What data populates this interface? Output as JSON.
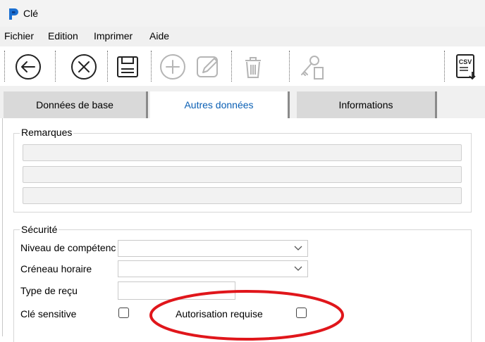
{
  "window": {
    "title": "Clé"
  },
  "menu": {
    "items": [
      "Fichier",
      "Edition",
      "Imprimer",
      "Aide"
    ]
  },
  "toolbar": {
    "buttons": [
      {
        "icon": "back-arrow-icon",
        "enabled": true
      },
      {
        "icon": "cancel-x-icon",
        "enabled": true
      },
      {
        "icon": "save-floppy-icon",
        "enabled": true
      },
      {
        "icon": "add-plus-icon",
        "enabled": false
      },
      {
        "icon": "edit-pencil-icon",
        "enabled": false
      },
      {
        "icon": "delete-trash-icon",
        "enabled": false
      },
      {
        "icon": "key-document-icon",
        "enabled": false
      },
      {
        "icon": "csv-export-icon",
        "enabled": true
      }
    ],
    "csv_label": "CSV"
  },
  "tabs": [
    {
      "label": "Données de base",
      "active": false
    },
    {
      "label": "Autres données",
      "active": true
    },
    {
      "label": "Informations",
      "active": false
    }
  ],
  "remarks": {
    "title": "Remarques",
    "lines": [
      "",
      "",
      ""
    ]
  },
  "security": {
    "title": "Sécurité",
    "level_label": "Niveau de compétenc",
    "level_value": "",
    "slot_label": "Créneau horaire",
    "slot_value": "",
    "receipt_label": "Type de reçu",
    "receipt_value": "",
    "sensitive_label": "Clé sensitive",
    "sensitive_checked": false,
    "auth_label": "Autorisation requise",
    "auth_checked": false
  },
  "colors": {
    "accent_tab_text": "#0a5fb4",
    "annotation": "#e0161b"
  }
}
